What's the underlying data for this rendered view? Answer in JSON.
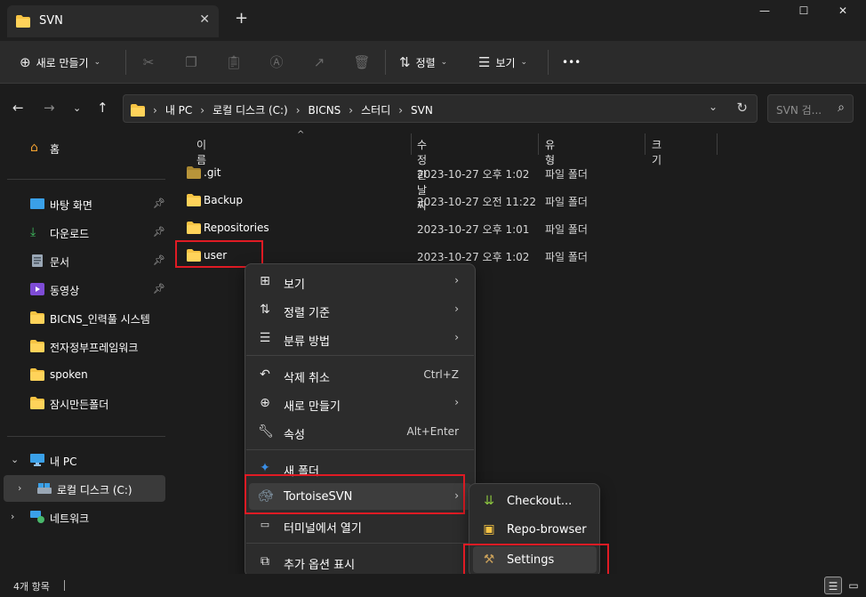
{
  "tab": {
    "title": "SVN"
  },
  "window": {
    "minimize": "—",
    "maximize": "☐",
    "close": "✕"
  },
  "toolbar": {
    "new_label": "새로 만들기",
    "sort_label": "정렬",
    "view_label": "보기",
    "more": "•••"
  },
  "address": {
    "crumbs": [
      "내 PC",
      "로컬 디스크 (C:)",
      "BICNS",
      "스터디",
      "SVN"
    ],
    "search_placeholder": "SVN 검..."
  },
  "sidebar": {
    "home": "홈",
    "quick": [
      {
        "label": "바탕 화면",
        "pinned": true
      },
      {
        "label": "다운로드",
        "pinned": true
      },
      {
        "label": "문서",
        "pinned": true
      },
      {
        "label": "동영상",
        "pinned": true
      },
      {
        "label": "BICNS_인력풀 시스템",
        "pinned": false
      },
      {
        "label": "전자정부프레임워크",
        "pinned": false
      },
      {
        "label": "spoken",
        "pinned": false
      },
      {
        "label": "잠시만든폴더",
        "pinned": false
      }
    ],
    "this_pc": "내 PC",
    "local_disk": "로컬 디스크 (C:)",
    "network": "네트워크"
  },
  "columns": {
    "name": "이름",
    "modified": "수정한 날짜",
    "type": "유형",
    "size": "크기"
  },
  "files": [
    {
      "name": ".git",
      "modified": "2023-10-27 오후 1:02",
      "type": "파일 폴더"
    },
    {
      "name": "Backup",
      "modified": "2023-10-27 오전 11:22",
      "type": "파일 폴더"
    },
    {
      "name": "Repositories",
      "modified": "2023-10-27 오후 1:01",
      "type": "파일 폴더"
    },
    {
      "name": "user",
      "modified": "2023-10-27 오후 1:02",
      "type": "파일 폴더"
    }
  ],
  "context_menu": {
    "view": "보기",
    "sort": "정렬 기준",
    "group": "분류 방법",
    "undo": "삭제 취소",
    "undo_shortcut": "Ctrl+Z",
    "new": "새로 만들기",
    "properties": "속성",
    "properties_shortcut": "Alt+Enter",
    "new_folder": "새 폴더",
    "tortoise": "TortoiseSVN",
    "terminal": "터미널에서 열기",
    "more_options": "추가 옵션 표시"
  },
  "submenu": {
    "checkout": "Checkout...",
    "repo_browser": "Repo-browser",
    "settings": "Settings"
  },
  "status": {
    "count": "4개 항목"
  },
  "colors": {
    "accent_folder": "#f6c343",
    "highlight_box": "#e01b24"
  }
}
